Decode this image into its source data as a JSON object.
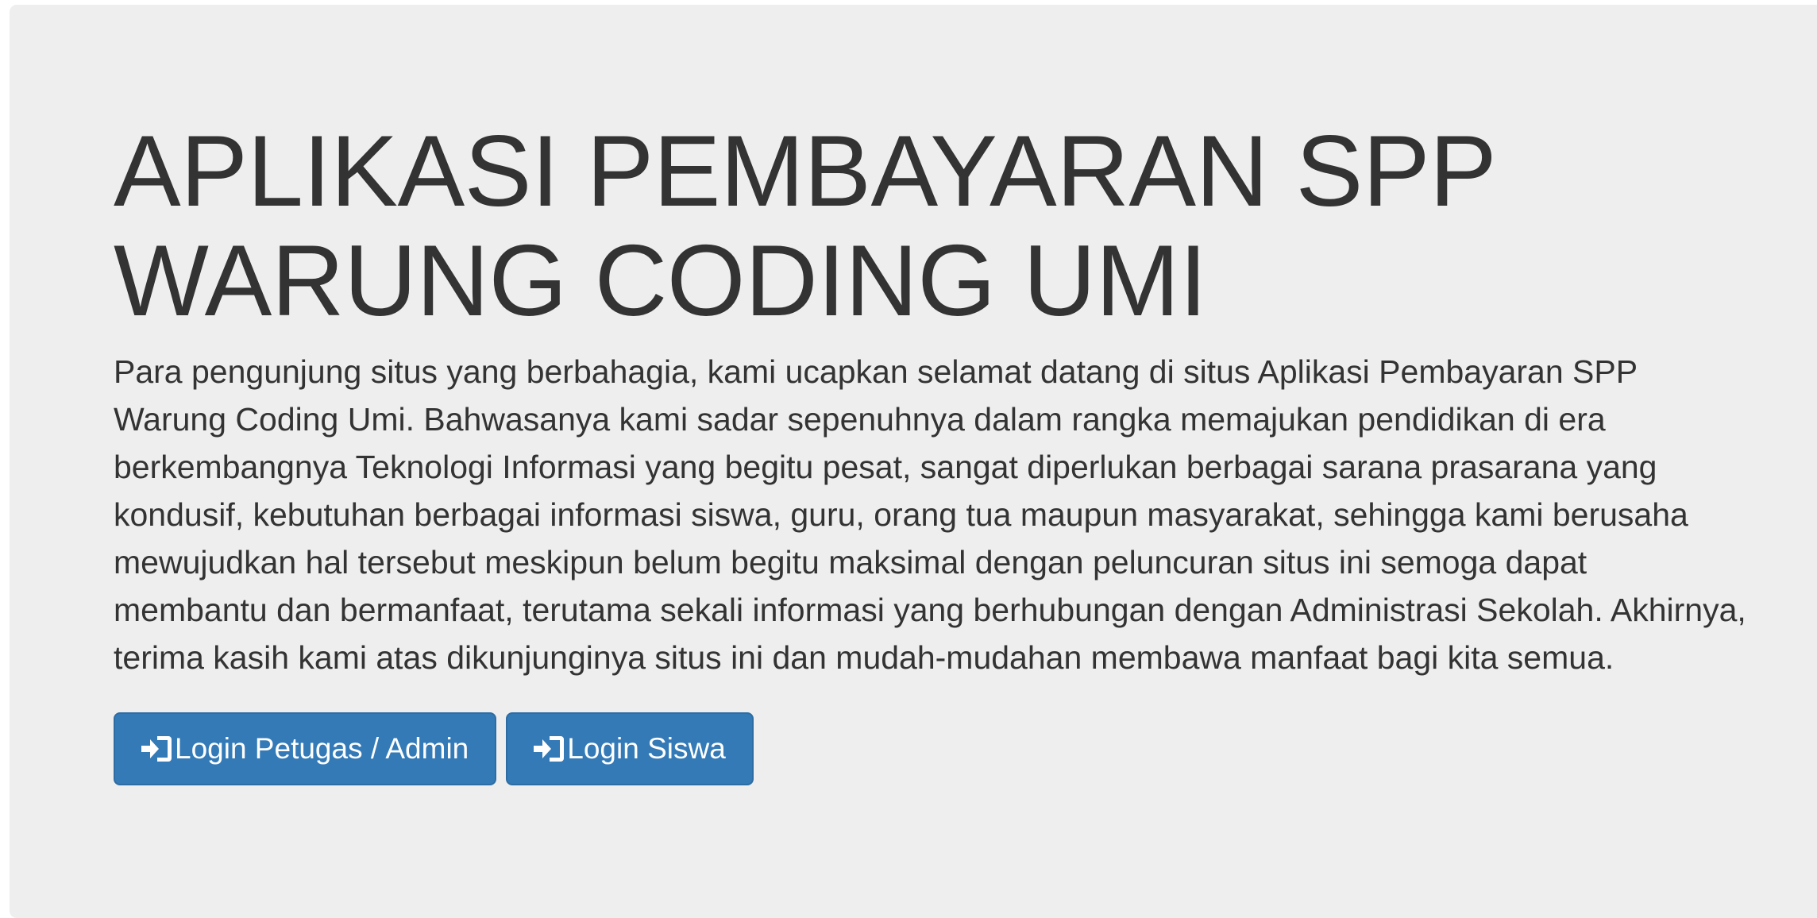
{
  "hero": {
    "title_line1": "APLIKASI PEMBAYARAN SPP",
    "title_line2": "WARUNG CODING UMI",
    "lead": "Para pengunjung situs yang berbahagia, kami ucapkan selamat datang di situs Aplikasi Pembayaran SPP Warung Coding Umi. Bahwasanya kami sadar sepenuhnya dalam rangka memajukan pendidikan di era berkembangnya Teknologi Informasi yang begitu pesat, sangat diperlukan berbagai sarana prasarana yang kondusif, kebutuhan berbagai informasi siswa, guru, orang tua maupun masyarakat, sehingga kami berusaha mewujudkan hal tersebut meskipun belum begitu maksimal dengan peluncuran situs ini semoga dapat membantu dan bermanfaat, terutama sekali informasi yang berhubungan dengan Administrasi Sekolah. Akhirnya, terima kasih kami atas dikunjunginya situs ini dan mudah-mudahan membawa manfaat bagi kita semua."
  },
  "buttons": {
    "login_admin": {
      "label": "Login Petugas / Admin",
      "icon": "log-in-icon"
    },
    "login_siswa": {
      "label": "Login Siswa",
      "icon": "log-in-icon"
    }
  },
  "colors": {
    "background": "#eeeeee",
    "text": "#333333",
    "button_primary": "#337ab7",
    "button_text": "#ffffff"
  }
}
